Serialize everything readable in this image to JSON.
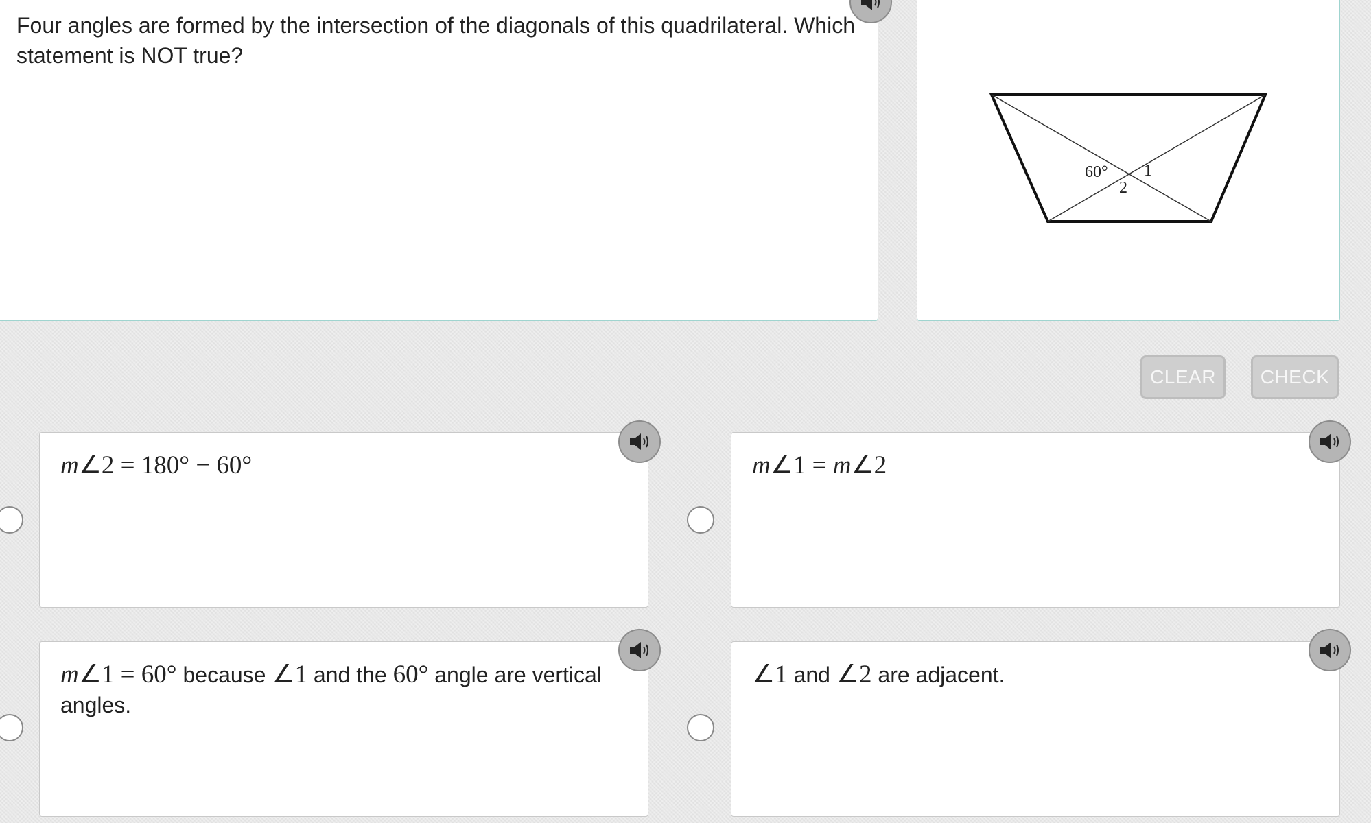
{
  "question": {
    "text": "Four angles are formed by the intersection of the diagonals of this quadrilateral. Which statement is NOT true?"
  },
  "figure": {
    "angle_label": "60°",
    "label_1": "1",
    "label_2": "2"
  },
  "buttons": {
    "clear_label": "CLEAR",
    "check_label": "CHECK"
  },
  "choices": [
    {
      "math_m": "m",
      "math_rest": "∠2 = 180° − 60°",
      "text": ""
    },
    {
      "math_m": "m",
      "math_rest": "∠1 = ",
      "math_m2": "m",
      "math_rest2": "∠2",
      "text": ""
    },
    {
      "math_m": "m",
      "math_rest": "∠1 = 60°",
      "text_a": " because ",
      "math_b": "∠1",
      "text_c": " and the ",
      "math_d": "60°",
      "text_e": " angle are vertical angles."
    },
    {
      "math_a": "∠1",
      "text_b": " and ",
      "math_c": "∠2",
      "text_d": " are adjacent."
    }
  ],
  "colors": {
    "panel_border": "#9fd4cf",
    "button_bg": "#cfcfcf",
    "audio_bg": "#b5b5b5",
    "background": "#e9e9e9"
  },
  "icons": {
    "audio": "speaker-icon",
    "radio": "radio-circle"
  }
}
